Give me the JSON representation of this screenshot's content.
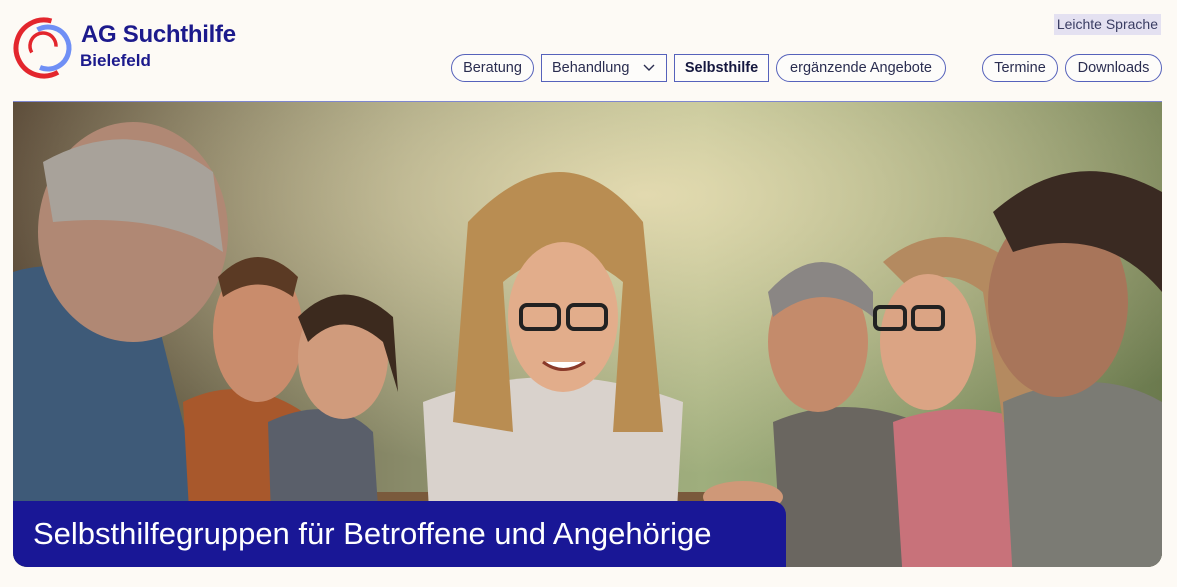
{
  "brand": {
    "name": "AG Suchthilfe",
    "city": "Bielefeld",
    "colors": {
      "primary": "#1c1a8c",
      "red": "#e3262d",
      "light_blue": "#6f8ff5"
    }
  },
  "top_links": {
    "easy_language": "Leichte Sprache"
  },
  "nav": {
    "beratung": "Beratung",
    "behandlung": "Behandlung",
    "selbsthilfe": "Selbsthilfe",
    "ergaenzende": "ergänzende Angebote",
    "termine": "Termine",
    "downloads": "Downloads",
    "active": "Selbsthilfe"
  },
  "hero": {
    "image": "photo of people laughing together at an outdoor table",
    "caption": "Selbsthilfegruppen für Betroffene und Angehörige",
    "caption_bg": "#191796"
  }
}
